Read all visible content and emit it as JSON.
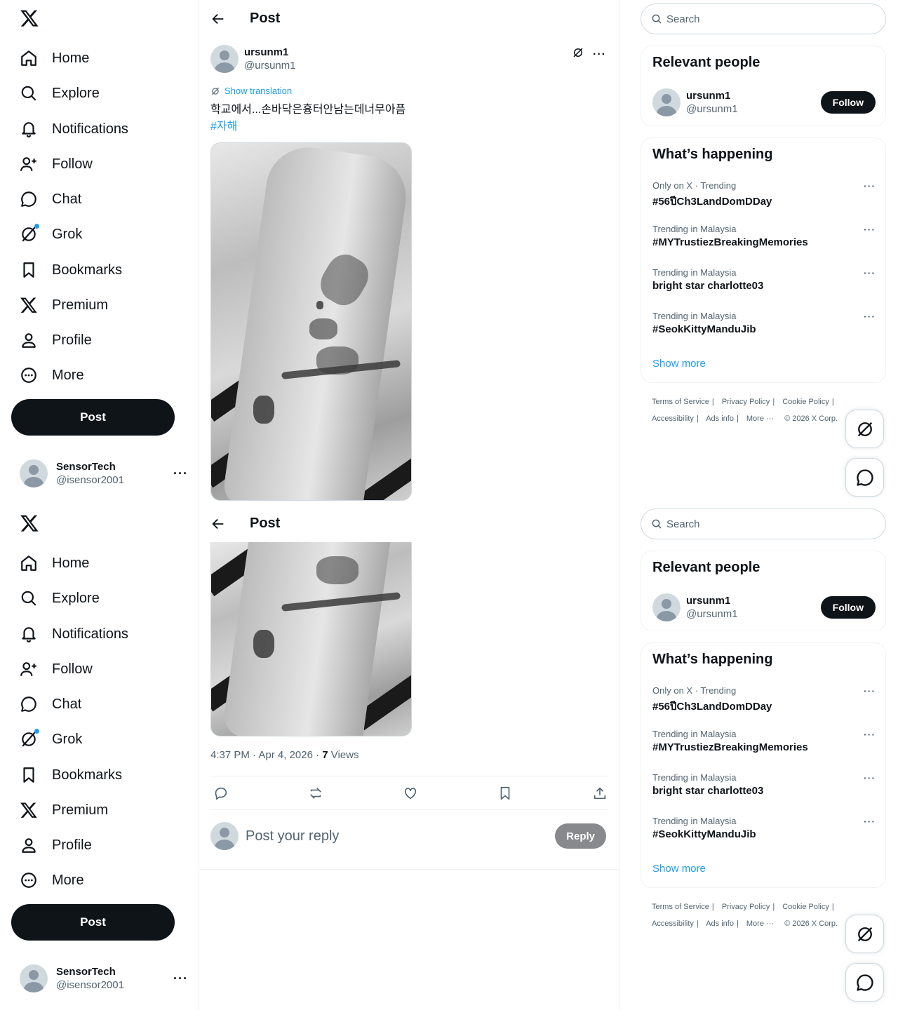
{
  "nav": {
    "items": [
      {
        "label": "Home",
        "icon": "home-icon"
      },
      {
        "label": "Explore",
        "icon": "search-icon"
      },
      {
        "label": "Notifications",
        "icon": "bell-icon"
      },
      {
        "label": "Follow",
        "icon": "person-add-icon"
      },
      {
        "label": "Chat",
        "icon": "chat-bubble-icon"
      },
      {
        "label": "Grok",
        "icon": "grok-icon"
      },
      {
        "label": "Bookmarks",
        "icon": "bookmark-icon"
      },
      {
        "label": "Premium",
        "icon": "x-logo-icon"
      },
      {
        "label": "Profile",
        "icon": "person-icon"
      },
      {
        "label": "More",
        "icon": "more-circle-icon"
      }
    ],
    "post_button": "Post",
    "account": {
      "name": "SensorTech",
      "handle": "@isensor2001"
    }
  },
  "header": {
    "title": "Post"
  },
  "post": {
    "author_name": "ursunm1",
    "author_handle": "@ursunm1",
    "show_translation": "Show translation",
    "text": "학교에서...손바닥은흉터안남는데너무아픔",
    "hashtag": "#자해",
    "timestamp": "4:37 PM · Apr 4, 2026 · ",
    "views_count": "7",
    "views_label": " Views"
  },
  "reply": {
    "placeholder": "Post your reply",
    "button": "Reply"
  },
  "sidebar": {
    "search_placeholder": "Search",
    "relevant": {
      "title": "Relevant people",
      "name": "ursunm1",
      "handle": "@ursunm1",
      "follow": "Follow"
    },
    "happening": {
      "title": "What’s happening",
      "trends": [
        {
          "context": "Only on X · Trending",
          "name": "#56ปีCh3LandDomDDay"
        },
        {
          "context": "Trending in Malaysia",
          "name": "#MYTrustiezBreakingMemories"
        },
        {
          "context": "Trending in Malaysia",
          "name": "bright star charlotte03"
        },
        {
          "context": "Trending in Malaysia",
          "name": "#SeokKittyManduJib"
        }
      ],
      "show_more": "Show more"
    },
    "footer": {
      "terms": "Terms of Service",
      "privacy": "Privacy Policy",
      "cookie": "Cookie Policy",
      "accessibility": "Accessibility",
      "ads": "Ads info",
      "more": "More ···",
      "copyright": "© 2026 X Corp."
    }
  },
  "colors": {
    "accent": "#1d9bf0",
    "text": "#0f1419",
    "muted": "#536471",
    "button_dark": "#0f1419"
  }
}
